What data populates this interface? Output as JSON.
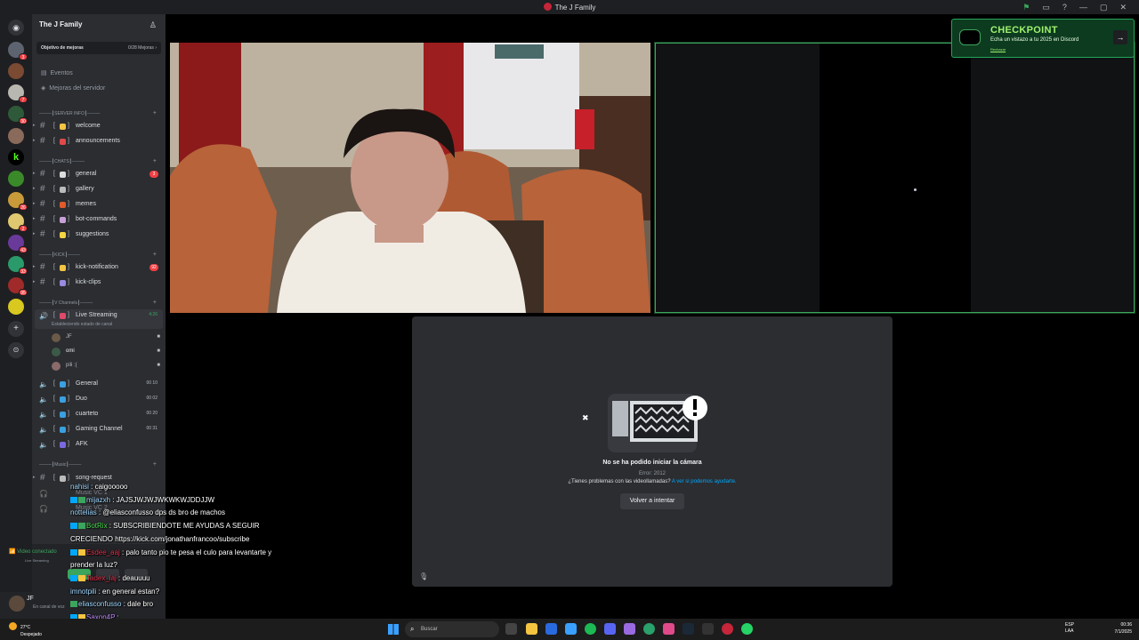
{
  "window": {
    "title": "The J Family"
  },
  "guild": {
    "name": "The J Family",
    "boost_label": "Objetivo de mejoras",
    "boost_count": "0/28 Mejoras ›",
    "events": "Eventos",
    "server_boosts": "Mejoras del servidor"
  },
  "server_badges": [
    "3",
    "7",
    "30",
    "26",
    "2",
    "43",
    "33",
    "95"
  ],
  "categories": {
    "server_info": "┃SERVER INFO┃",
    "chats": "┃CHATS┃",
    "kick": "┃KICK┃",
    "v_channels": "┃V Channels┃",
    "music": "┃Music┃"
  },
  "channels": {
    "welcome": "welcome",
    "announcements": "announcements",
    "general": "general",
    "general_count": "3",
    "gallery": "gallery",
    "memes": "memes",
    "bot_commands": "bot-commands",
    "suggestions": "suggestions",
    "kick_notification": "kick-notification",
    "kick_notification_count": "92",
    "kick_clips": "kick-clips",
    "live_streaming": "Live Streaming",
    "live_streaming_time": "4:26",
    "live_streaming_status": "Estableciendo estado de canal",
    "vc_general": "General",
    "vc_general_count": "00 10",
    "vc_duo": "Duo",
    "vc_duo_count": "00 02",
    "vc_cuarteto": "cuarteto",
    "vc_cuarteto_count": "00 20",
    "vc_gaming": "Gaming Channel",
    "vc_gaming_count": "00 31",
    "vc_afk": "AFK",
    "song_request": "song-request",
    "music_vc1": "Music VC 1",
    "music_vc2": "Music VC 2"
  },
  "members": [
    {
      "name": "JF",
      "color": "#6b5a48"
    },
    {
      "name": "omi",
      "color": "#3d5a48"
    },
    {
      "name": "pili :(",
      "color": "#8a6a6a"
    }
  ],
  "voice": {
    "status": "Video conectado",
    "channel": "Live Streaming"
  },
  "user": {
    "name": "JF",
    "status": "En canal de voz"
  },
  "camera": {
    "title": "No se ha podido iniciar la cámara",
    "error": "Error: 2012",
    "help": "¿Tienes problemas con las videollamadas?",
    "help_link": "A ver si podemos ayudarte.",
    "retry": "Volver a intentar"
  },
  "checkpoint": {
    "title": "CHECKPOINT",
    "subtitle": "Echa un vistazo a tu 2025 en Discord",
    "dismiss": "Rechazar"
  },
  "chat": [
    {
      "user": "nahisi",
      "msg": "caigooooo"
    },
    {
      "user": "mijazxh",
      "msg": "JAJSJWJWJWKWKWJDDJJW"
    },
    {
      "user": "nottelias",
      "msg": "@eliasconfusso dps ds bro de machos"
    },
    {
      "user": "BotRix",
      "msg": "SUBSCRIBIENDOTE ME AYUDAS A SEGUIR CRECIENDO https://kick.com/jonathanfrancoo/subscribe"
    },
    {
      "user": "Esdee_aaj",
      "msg": "palo tanto pio te pesa el culo para levantarte y prender la luz?"
    },
    {
      "user": "Tadex_laj",
      "msg": "deauuuu"
    },
    {
      "user": "imnotpili",
      "msg": "en general estan?"
    },
    {
      "user": "eliasconfusso",
      "msg": "dale bro"
    },
    {
      "user": "Saxon4P",
      "msg": ""
    }
  ],
  "taskbar": {
    "temp": "27°C",
    "weather": "Despejado",
    "search": "Buscar",
    "lang1": "ESP",
    "lang2": "LAA",
    "time": "00:36",
    "date": "7/1/2025"
  },
  "colors": {
    "accent_green": "#23a55a",
    "discord_bg": "#2b2d31",
    "badge_red": "#f23f43"
  }
}
